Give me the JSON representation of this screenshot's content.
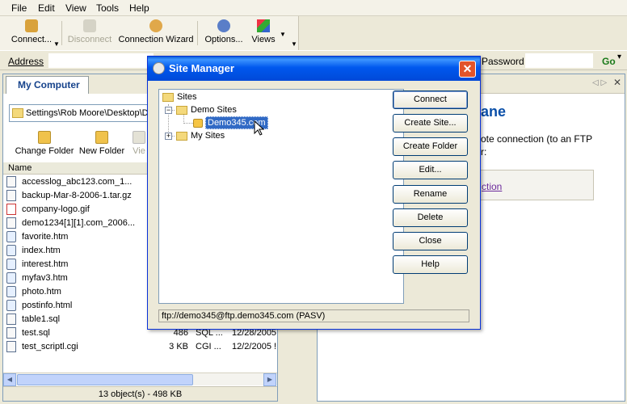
{
  "menu": [
    "File",
    "Edit",
    "View",
    "Tools",
    "Help"
  ],
  "toolbar": {
    "connect": "Connect...",
    "disconnect": "Disconnect",
    "wizard": "Connection Wizard",
    "options": "Options...",
    "views": "Views"
  },
  "address": {
    "label": "Address",
    "password_label": "Password",
    "go": "Go"
  },
  "left_panel": {
    "tab": "My Computer",
    "path": "Settings\\Rob Moore\\Desktop\\D",
    "change_folder": "Change Folder",
    "new_folder": "New Folder",
    "view_truncated": "Vie",
    "column_name": "Name",
    "files": [
      {
        "name": "accesslog_abc123.com_1...",
        "size": "",
        "type": "",
        "date": "",
        "icon": "doc"
      },
      {
        "name": "backup-Mar-8-2006-1.tar.gz",
        "size": "",
        "type": "",
        "date": "",
        "icon": "doc"
      },
      {
        "name": "company-logo.gif",
        "size": "",
        "type": "",
        "date": "",
        "icon": "gif"
      },
      {
        "name": "demo1234[1][1].com_2006...",
        "size": "",
        "type": "",
        "date": "",
        "icon": "doc"
      },
      {
        "name": "favorite.htm",
        "size": "",
        "type": "",
        "date": "",
        "icon": "web"
      },
      {
        "name": "index.htm",
        "size": "",
        "type": "",
        "date": "",
        "icon": "web"
      },
      {
        "name": "interest.htm",
        "size": "",
        "type": "",
        "date": "",
        "icon": "web"
      },
      {
        "name": "myfav3.htm",
        "size": "",
        "type": "",
        "date": "",
        "icon": "web"
      },
      {
        "name": "photo.htm",
        "size": "",
        "type": "",
        "date": "",
        "icon": "web"
      },
      {
        "name": "postinfo.html",
        "size": "",
        "type": "",
        "date": "",
        "icon": "web"
      },
      {
        "name": "table1.sql",
        "size": "",
        "type": "",
        "date": "",
        "icon": "doc"
      },
      {
        "name": "test.sql",
        "size": "486",
        "type": "SQL ...",
        "date": "12/28/2005",
        "icon": "doc"
      },
      {
        "name": "test_scriptl.cgi",
        "size": "3 KB",
        "type": "CGI ...",
        "date": "12/2/2005 !",
        "icon": "doc"
      }
    ],
    "status": "13 object(s) - 498 KB"
  },
  "right_panel": {
    "title_fragment": "ane",
    "text_line1": "ote connection (to an FTP",
    "text_line2": "r:",
    "link_fragment": "ction"
  },
  "dialog": {
    "title": "Site Manager",
    "close": "✕",
    "tree": {
      "root": "Sites",
      "group1": "Demo Sites",
      "site1": "Demo345.com",
      "group2": "My Sites"
    },
    "buttons": [
      "Connect",
      "Create Site...",
      "Create Folder",
      "Edit...",
      "Rename",
      "Delete",
      "Close",
      "Help"
    ],
    "status": "ftp://demo345@ftp.demo345.com (PASV)"
  },
  "colors": {
    "title_bar": "#0058ee",
    "selection": "#316ac5",
    "accent_link": "#0a4fa8",
    "go": "#1a7a1a"
  }
}
